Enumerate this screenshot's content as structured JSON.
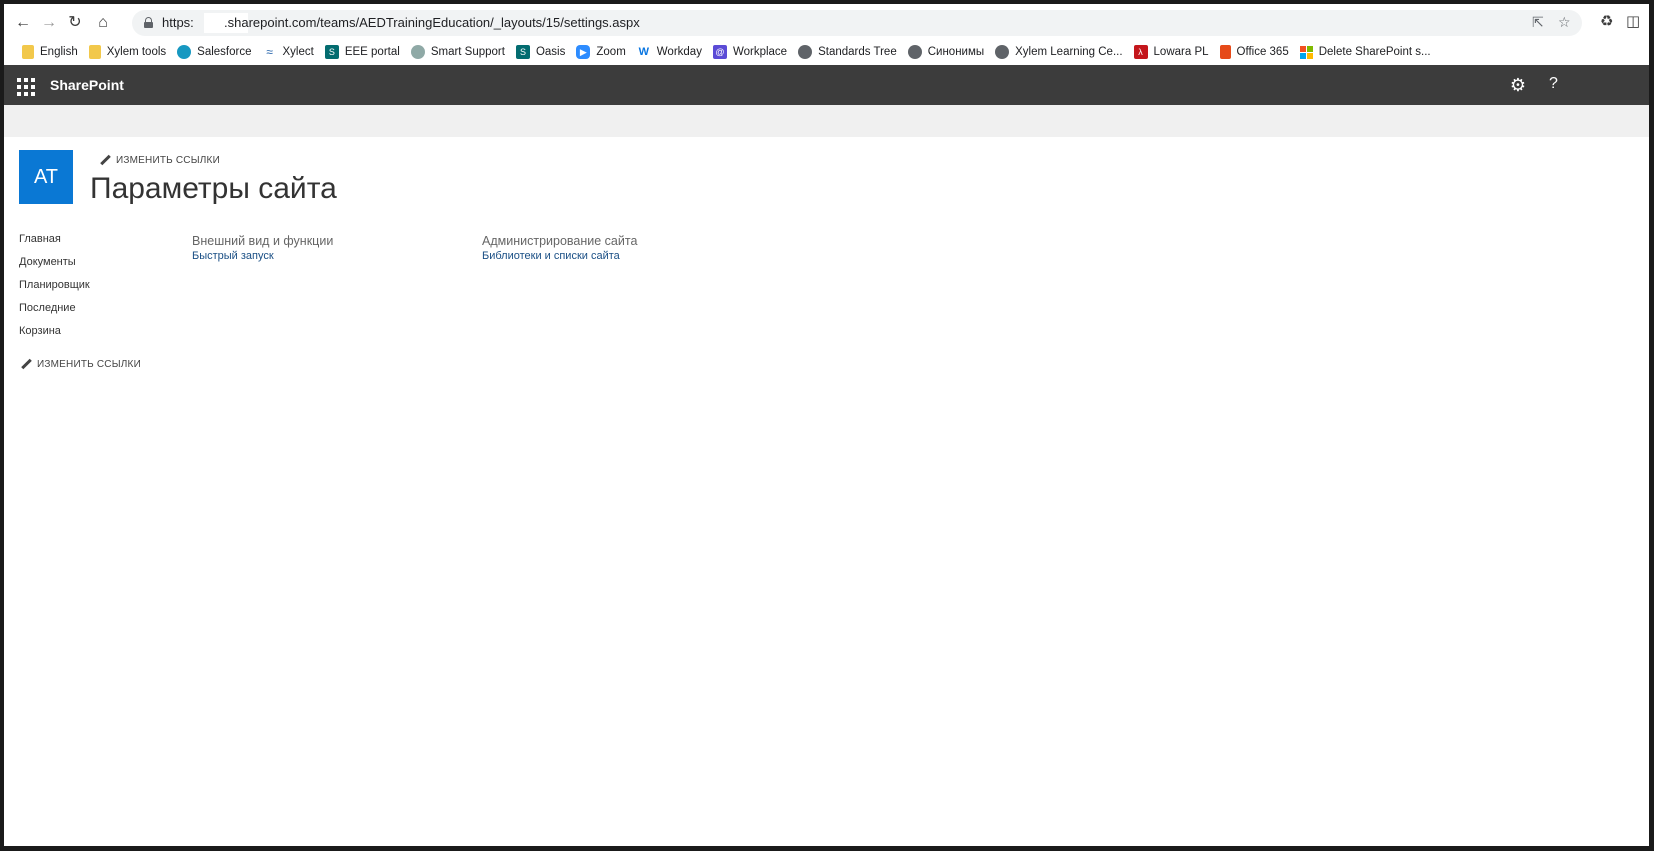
{
  "browser": {
    "url_prefix": "https:",
    "url_rest": ".sharepoint.com/teams/AEDTrainingEducation/_layouts/15/settings.aspx",
    "icons": {
      "back": "back-arrow-icon",
      "forward": "forward-arrow-icon",
      "reload": "reload-icon",
      "home": "home-icon",
      "share": "share-icon",
      "bookmark": "star-icon",
      "extensions": "puzzle-icon",
      "sidepanel": "side-panel-icon"
    }
  },
  "bookmarks": [
    {
      "label": "English",
      "icon": "folder"
    },
    {
      "label": "Xylem tools",
      "icon": "folder"
    },
    {
      "label": "Salesforce",
      "icon": "salesforce"
    },
    {
      "label": "Xylect",
      "icon": "xylect"
    },
    {
      "label": "EEE portal",
      "icon": "sharepoint"
    },
    {
      "label": "Smart Support",
      "icon": "support"
    },
    {
      "label": "Oasis",
      "icon": "sharepoint"
    },
    {
      "label": "Zoom",
      "icon": "zoom"
    },
    {
      "label": "Workday",
      "icon": "workday"
    },
    {
      "label": "Workplace",
      "icon": "workplace"
    },
    {
      "label": "Standards Tree",
      "icon": "globe"
    },
    {
      "label": "Синонимы",
      "icon": "globe"
    },
    {
      "label": "Xylem Learning Ce...",
      "icon": "globe"
    },
    {
      "label": "Lowara PL",
      "icon": "pdf"
    },
    {
      "label": "Office 365",
      "icon": "office"
    },
    {
      "label": "Delete SharePoint s...",
      "icon": "microsoft"
    }
  ],
  "suitebar": {
    "brand": "SharePoint",
    "help": "?"
  },
  "site": {
    "logo_text": "AT",
    "edit_links_top": "ИЗМЕНИТЬ ССЫЛКИ",
    "title": "Параметры сайта",
    "accent": "#0a78d4"
  },
  "leftnav": {
    "items": [
      "Главная",
      "Документы",
      "Планировщик",
      "Последние",
      "Корзина"
    ],
    "edit_links": "ИЗМЕНИТЬ ССЫЛКИ"
  },
  "settings": {
    "look_feel": {
      "header": "Внешний вид и функции",
      "links": [
        "Быстрый запуск"
      ]
    },
    "site_admin": {
      "header": "Администрирование сайта",
      "links": [
        "Библиотеки и списки сайта"
      ]
    }
  }
}
